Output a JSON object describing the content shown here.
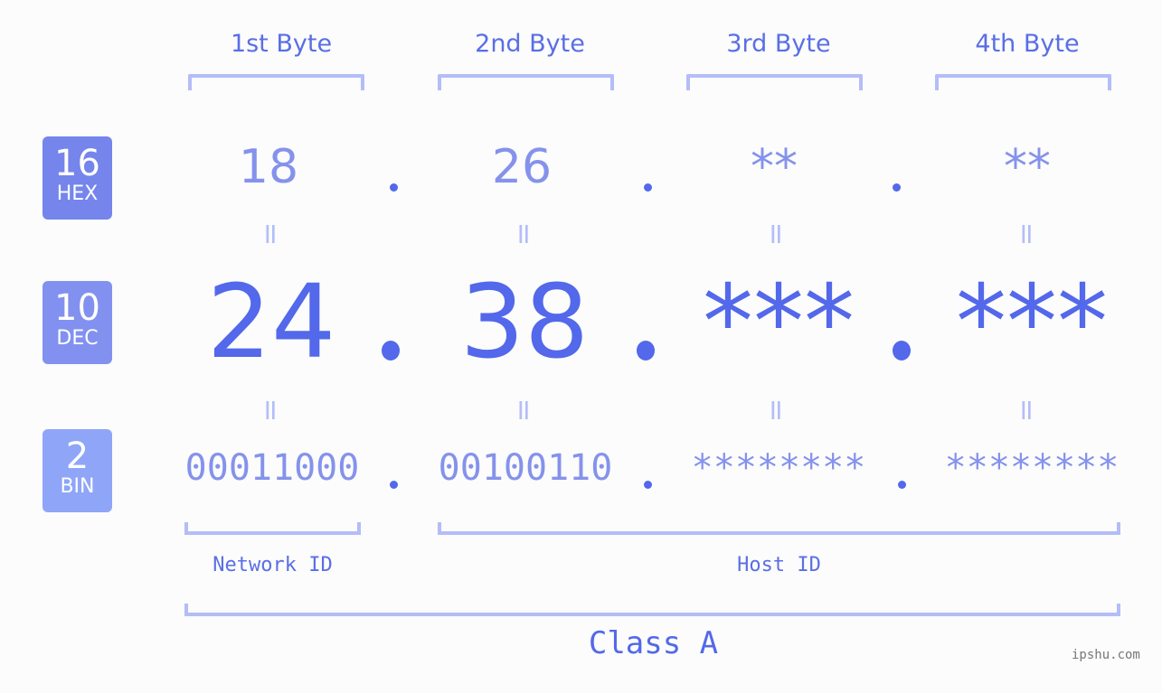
{
  "bytes": {
    "labels": [
      "1st Byte",
      "2nd Byte",
      "3rd Byte",
      "4th Byte"
    ]
  },
  "badges": {
    "hex": {
      "num": "16",
      "txt": "HEX",
      "color": "#7585ec"
    },
    "dec": {
      "num": "10",
      "txt": "DEC",
      "color": "#8291f0"
    },
    "bin": {
      "num": "2",
      "txt": "BIN",
      "color": "#8fa5f8"
    }
  },
  "hex": [
    "18",
    "26",
    "**",
    "**"
  ],
  "dec": [
    "24",
    "38",
    "***",
    "***"
  ],
  "bin": [
    "00011000",
    "00100110",
    "********",
    "********"
  ],
  "equals": "=",
  "segments": {
    "network_id": "Network ID",
    "host_id": "Host ID",
    "class": "Class A"
  },
  "watermark": "ipshu.com",
  "colors": {
    "primary": "#5368ea",
    "light": "#8592ec",
    "bracket": "#b4bdf8"
  }
}
